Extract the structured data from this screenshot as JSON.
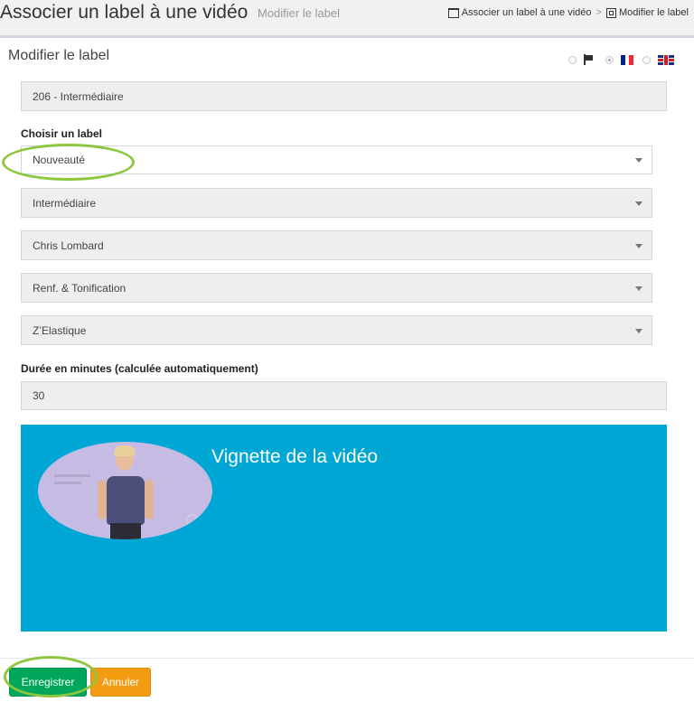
{
  "header": {
    "title": "Associer un label à une vidéo",
    "subtitle": "Modifier le label",
    "breadcrumb": [
      "Associer un label à une vidéo",
      "Modifier le label"
    ],
    "separator": ">"
  },
  "panel": {
    "title": "Modifier le label",
    "languages": [
      {
        "icon": "flag-icon",
        "selected": false
      },
      {
        "icon": "french-flag-icon",
        "selected": true,
        "colors": [
          "#002395",
          "#ffffff",
          "#ed2939"
        ]
      },
      {
        "icon": "uk-flag-icon",
        "selected": false
      }
    ]
  },
  "form": {
    "reference": "206 - Intermédiaire",
    "choose_label": "Choisir un label",
    "selects": [
      "Nouveauté",
      "Intermédiaire",
      "Chris Lombard",
      "Renf. & Tonification",
      "Z’Elastique"
    ],
    "duration_label": "Durée en minutes (calculée automatiquement)",
    "duration_value": "30"
  },
  "thumbnail": {
    "title": "Vignette de la vidéo",
    "background": "#00a7d5"
  },
  "actions": {
    "save_label": "Enregistrer",
    "cancel_label": "Annuler",
    "save_color": "#00a65a",
    "cancel_color": "#f39c12",
    "highlight_color": "#8dc63f"
  }
}
